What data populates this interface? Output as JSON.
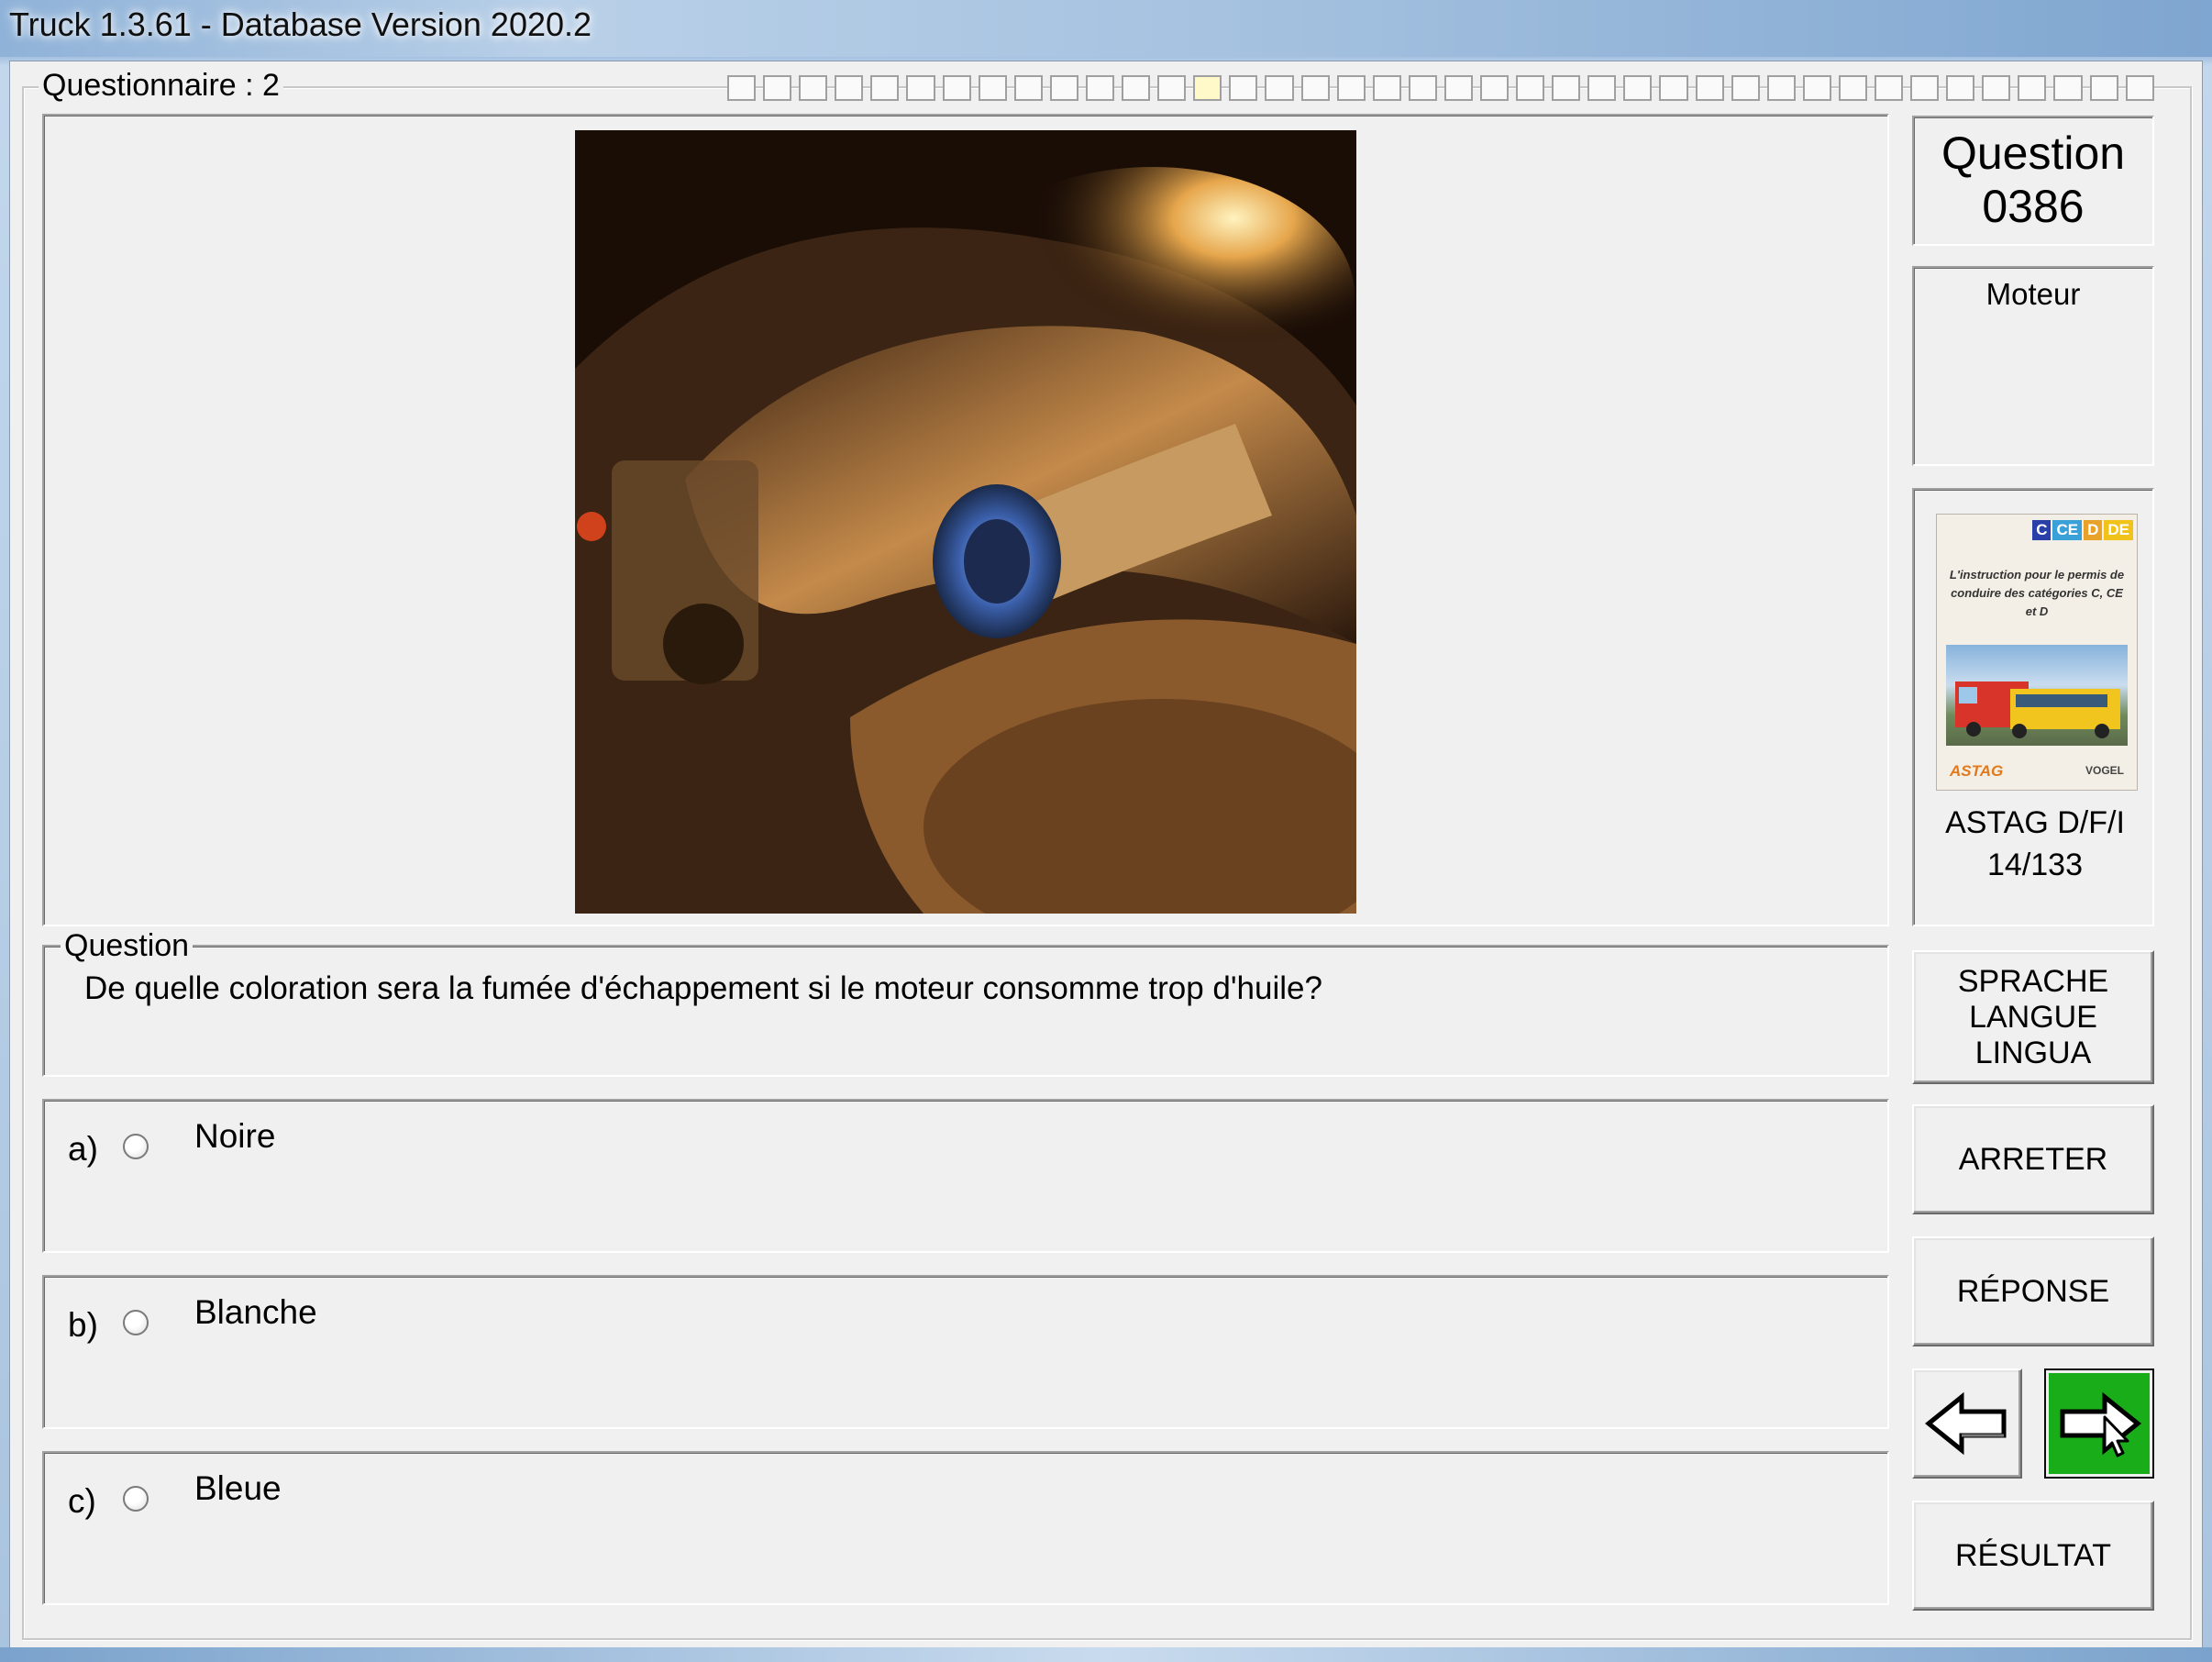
{
  "window": {
    "title": "Truck 1.3.61 - Database Version 2020.2"
  },
  "questionnaire": {
    "label": "Questionnaire : 2",
    "progress_total": 40,
    "progress_current": 14
  },
  "question": {
    "group_label": "Question",
    "text": "De quelle coloration sera la fumée d'échappement si le moteur consomme trop d'huile?",
    "number_label": "Question",
    "number": "0386",
    "category": "Moteur"
  },
  "answers": [
    {
      "letter": "a)",
      "text": "Noire",
      "selected": false
    },
    {
      "letter": "b)",
      "text": "Blanche",
      "selected": false
    },
    {
      "letter": "c)",
      "text": "Bleue",
      "selected": false
    }
  ],
  "source": {
    "book_categories": [
      "C",
      "CE",
      "D",
      "DE"
    ],
    "book_title": "L'instruction pour le permis de conduire des catégories C, CE et D",
    "book_logo": "ASTAG",
    "book_logo2": "VOGEL",
    "caption_line1": "ASTAG D/F/I",
    "caption_line2": "14/133"
  },
  "buttons": {
    "language": [
      "SPRACHE",
      "LANGUE",
      "LINGUA"
    ],
    "stop": "ARRETER",
    "answer": "RÉPONSE",
    "prev_icon": "arrow-left-icon",
    "next_icon": "arrow-right-cursor-icon",
    "result": "RÉSULTAT"
  },
  "colors": {
    "next_button": "#1aad1a",
    "window_bg": "#f0f0f0"
  }
}
